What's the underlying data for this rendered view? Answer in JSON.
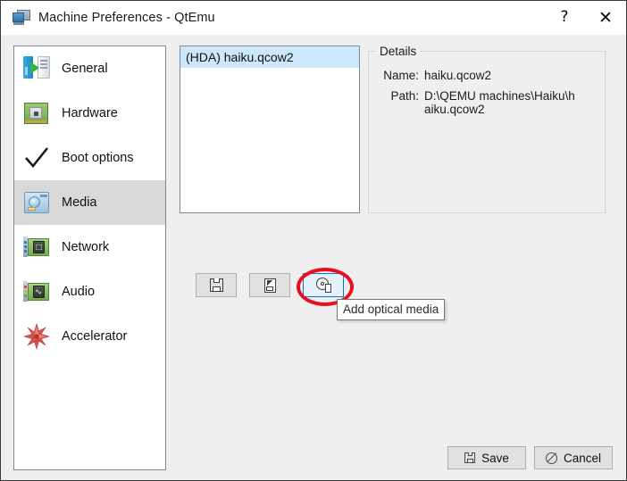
{
  "window": {
    "title": "Machine Preferences - QtEmu",
    "icon": "computer-icon",
    "help_label": "?",
    "close_label": "✕"
  },
  "sidebar": {
    "items": [
      {
        "label": "General",
        "icon": "general-icon",
        "selected": false
      },
      {
        "label": "Hardware",
        "icon": "hardware-icon",
        "selected": false
      },
      {
        "label": "Boot options",
        "icon": "checkmark-icon",
        "selected": false
      },
      {
        "label": "Media",
        "icon": "harddisk-icon",
        "selected": true
      },
      {
        "label": "Network",
        "icon": "network-card-icon",
        "selected": false
      },
      {
        "label": "Audio",
        "icon": "audio-card-icon",
        "selected": false
      },
      {
        "label": "Accelerator",
        "icon": "starburst-icon",
        "selected": false
      }
    ]
  },
  "media": {
    "list": [
      {
        "label": "(HDA) haiku.qcow2",
        "selected": true
      }
    ],
    "toolbar": [
      {
        "name": "add-hard-disk-button",
        "icon": "floppy-icon",
        "hovered": false
      },
      {
        "name": "add-floppy-media-button",
        "icon": "floppy-edit-icon",
        "hovered": false
      },
      {
        "name": "add-optical-media-button",
        "icon": "optical-disc-icon",
        "hovered": true
      }
    ],
    "tooltip": "Add optical media"
  },
  "details": {
    "legend": "Details",
    "rows": [
      {
        "key": "Name:",
        "value": "haiku.qcow2"
      },
      {
        "key": "Path:",
        "value": "D:\\QEMU machines\\Haiku\\haiku.qcow2"
      }
    ]
  },
  "footer": {
    "save_label": "Save",
    "cancel_label": "Cancel"
  },
  "colors": {
    "selection_list": "#cde8fa",
    "selection_sidebar": "#d9d9d9",
    "hover_accent": "#0078d7",
    "annotation": "#e8101a",
    "dialog_bg": "#efefef"
  }
}
